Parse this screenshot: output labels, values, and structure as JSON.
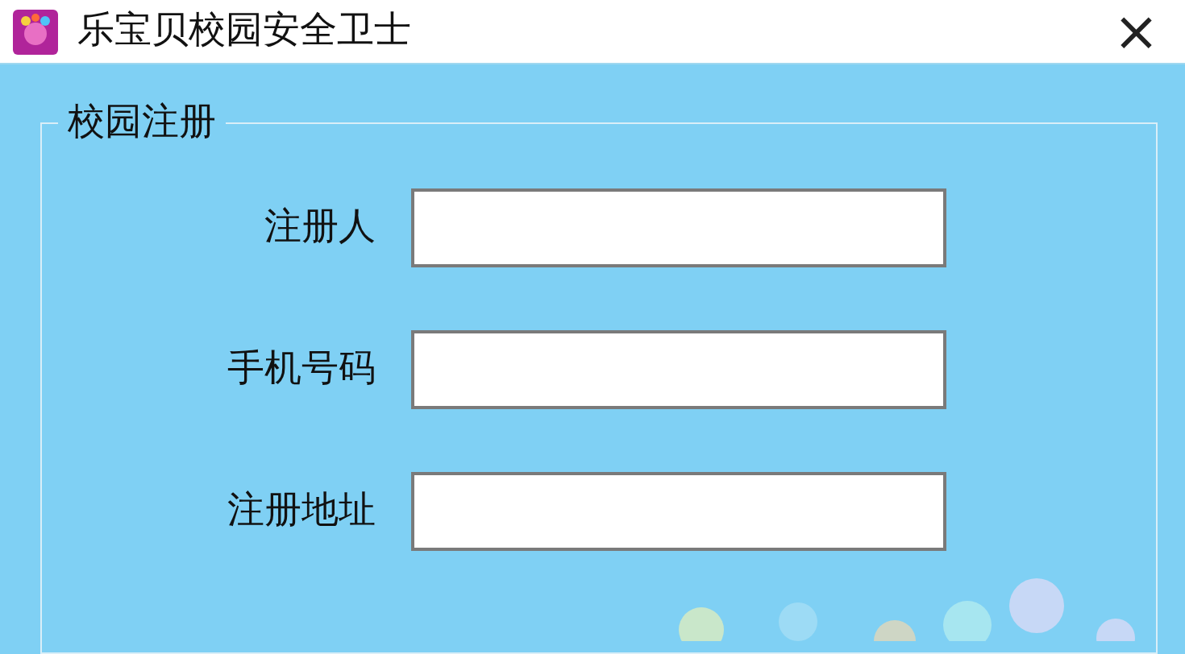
{
  "window": {
    "title": "乐宝贝校园安全卫士",
    "close": "×"
  },
  "group": {
    "title": "校园注册"
  },
  "fields": [
    {
      "label": "注册人"
    },
    {
      "label": "手机号码"
    },
    {
      "label": "注册地址"
    }
  ]
}
